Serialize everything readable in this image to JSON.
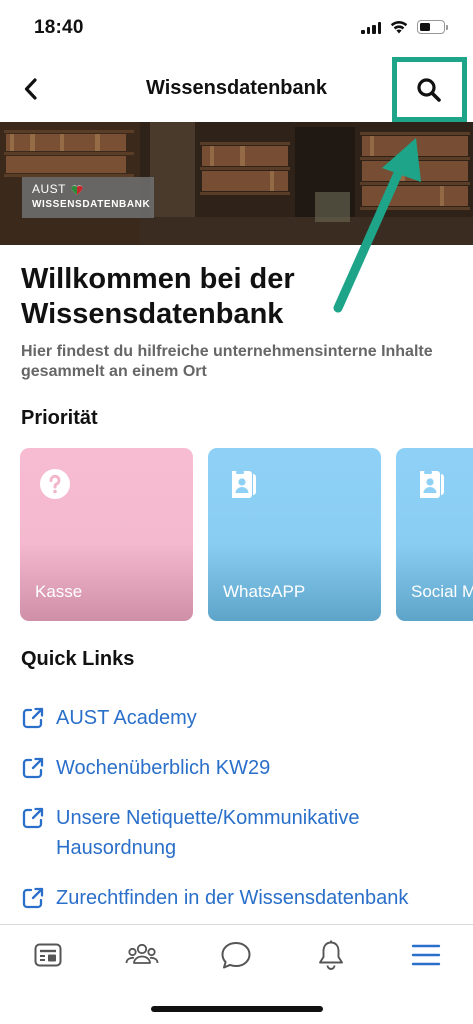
{
  "status_bar": {
    "time": "18:40"
  },
  "nav": {
    "title": "Wissensdatenbank",
    "back_icon": "chevron-left-icon",
    "search_icon": "search-icon"
  },
  "hero": {
    "logo_brand": "AUST",
    "logo_title": "WISSENSDATENBANK"
  },
  "welcome": {
    "title": "Willkommen bei der Wissensdatenbank",
    "subtitle": "Hier findest du hilfreiche unternehmensinterne Inhalte gesammelt an einem Ort"
  },
  "priority": {
    "title": "Priorität",
    "cards": [
      {
        "label": "Kasse",
        "icon": "question-icon",
        "color": "#f9bdd2"
      },
      {
        "label": "WhatsAPP",
        "icon": "contact-card-icon",
        "color": "#8dd0f5"
      },
      {
        "label": "Social Media",
        "icon": "contact-card-icon",
        "color": "#8dd0f5"
      }
    ]
  },
  "quick_links": {
    "title": "Quick Links",
    "items": [
      {
        "label": "AUST Academy"
      },
      {
        "label": "Wochenüberblich KW29"
      },
      {
        "label": "Unsere Netiquette/Kommunikative Hausordnung"
      },
      {
        "label": "Zurechtfinden in der Wissensdatenbank"
      }
    ]
  },
  "tab_bar": {
    "tabs": [
      {
        "icon": "news-feed-icon"
      },
      {
        "icon": "people-icon"
      },
      {
        "icon": "chat-bubble-icon"
      },
      {
        "icon": "bell-icon"
      },
      {
        "icon": "menu-icon",
        "active": true
      }
    ]
  },
  "colors": {
    "accent": "#2a6fc9",
    "annotation": "#1ea589"
  }
}
